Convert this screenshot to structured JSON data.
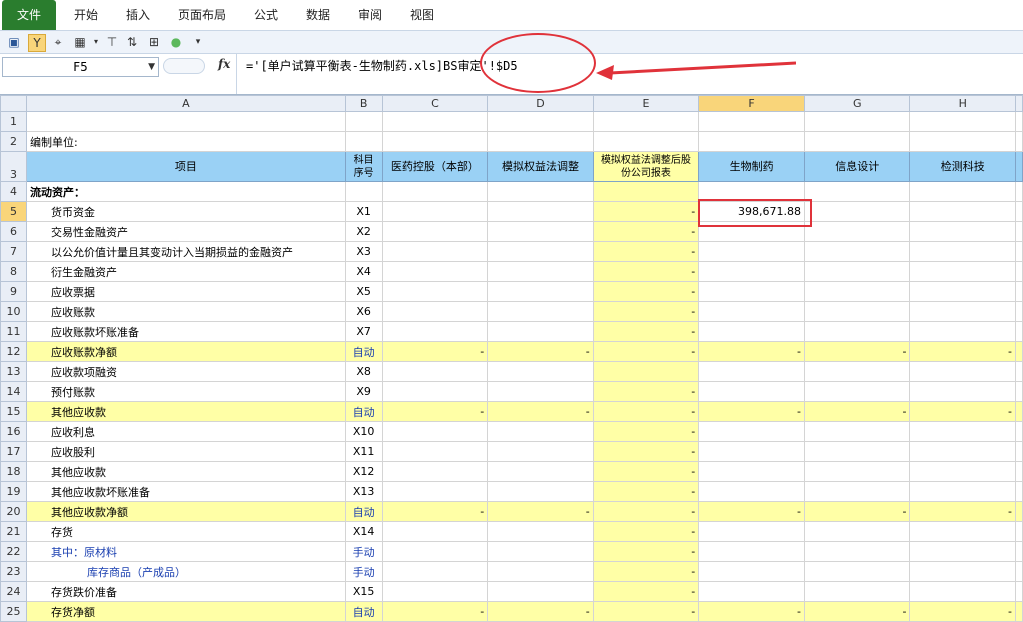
{
  "ribbon": {
    "file": "文件",
    "tabs": [
      "开始",
      "插入",
      "页面布局",
      "公式",
      "数据",
      "审阅",
      "视图"
    ]
  },
  "formula_bar": {
    "name_box": "F5",
    "fx": "fx",
    "formula": "='[单户试算平衡表-生物制药.xls]BS审定'!$D5"
  },
  "columns": [
    "A",
    "B",
    "C",
    "D",
    "E",
    "F",
    "G",
    "H"
  ],
  "header_row": {
    "item": "项目",
    "seq": "科目序号",
    "c": "医药控股（本部）",
    "d": "模拟权益法调整",
    "e": "模拟权益法调整后股份公司报表",
    "f": "生物制药",
    "g": "信息设计",
    "h": "检测科技"
  },
  "row2_label": "编制单位:",
  "row4_label": "流动资产：",
  "rows": [
    {
      "n": "5",
      "a": "货币资金",
      "b": "X1",
      "e": "-",
      "f": "398,671.88",
      "y": false,
      "indent": 1
    },
    {
      "n": "6",
      "a": "交易性金融资产",
      "b": "X2",
      "e": "-",
      "y": false,
      "indent": 1
    },
    {
      "n": "7",
      "a": "以公允价值计量且其变动计入当期损益的金融资产",
      "b": "X3",
      "e": "-",
      "y": false,
      "indent": 1
    },
    {
      "n": "8",
      "a": "衍生金融资产",
      "b": "X4",
      "e": "-",
      "y": false,
      "indent": 1
    },
    {
      "n": "9",
      "a": "应收票据",
      "b": "X5",
      "e": "-",
      "y": false,
      "indent": 1
    },
    {
      "n": "10",
      "a": "应收账款",
      "b": "X6",
      "e": "-",
      "y": false,
      "indent": 1
    },
    {
      "n": "11",
      "a": "应收账款坏账准备",
      "b": "X7",
      "e": "-",
      "y": false,
      "indent": 1
    },
    {
      "n": "12",
      "a": "应收账款净额",
      "b": "自动",
      "c": "-",
      "d": "-",
      "e": "-",
      "f": "-",
      "g": "-",
      "h": "-",
      "y": true,
      "indent": 1
    },
    {
      "n": "13",
      "a": "应收款项融资",
      "b": "X8",
      "y": false,
      "indent": 1
    },
    {
      "n": "14",
      "a": "预付账款",
      "b": "X9",
      "e": "-",
      "y": false,
      "indent": 1
    },
    {
      "n": "15",
      "a": "其他应收款",
      "b": "自动",
      "c": "-",
      "d": "-",
      "e": "-",
      "f": "-",
      "g": "-",
      "h": "-",
      "y": true,
      "indent": 1
    },
    {
      "n": "16",
      "a": "应收利息",
      "b": "X10",
      "e": "-",
      "y": false,
      "indent": 1
    },
    {
      "n": "17",
      "a": "应收股利",
      "b": "X11",
      "e": "-",
      "y": false,
      "indent": 1
    },
    {
      "n": "18",
      "a": "其他应收款",
      "b": "X12",
      "e": "-",
      "y": false,
      "indent": 1
    },
    {
      "n": "19",
      "a": "其他应收款坏账准备",
      "b": "X13",
      "e": "-",
      "y": false,
      "indent": 1
    },
    {
      "n": "20",
      "a": "其他应收款净额",
      "b": "自动",
      "c": "-",
      "d": "-",
      "e": "-",
      "f": "-",
      "g": "-",
      "h": "-",
      "y": true,
      "indent": 1
    },
    {
      "n": "21",
      "a": "存货",
      "b": "X14",
      "e": "-",
      "y": false,
      "indent": 1
    },
    {
      "n": "22",
      "a": "其中：原材料",
      "b": "手动",
      "e": "-",
      "y": false,
      "indent": 1,
      "blue": true
    },
    {
      "n": "23",
      "a": "库存商品（产成品）",
      "b": "手动",
      "e": "-",
      "y": false,
      "indent": 2,
      "blue": true
    },
    {
      "n": "24",
      "a": "存货跌价准备",
      "b": "X15",
      "e": "-",
      "y": false,
      "indent": 1
    },
    {
      "n": "25",
      "a": "存货净额",
      "b": "自动",
      "c": "-",
      "d": "-",
      "e": "-",
      "f": "-",
      "g": "-",
      "h": "-",
      "y": true,
      "indent": 1
    }
  ]
}
